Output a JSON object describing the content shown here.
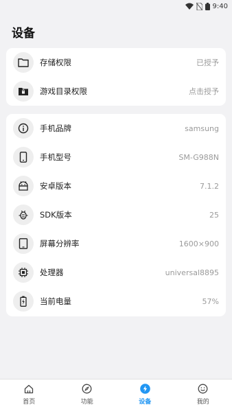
{
  "status_bar": {
    "time": "9:40"
  },
  "header": {
    "title": "设备"
  },
  "permissions": [
    {
      "label": "存储权限",
      "value": "已授予",
      "icon": "folder-icon"
    },
    {
      "label": "游戏目录权限",
      "value": "点击授予",
      "icon": "folder-lock-icon"
    }
  ],
  "device_info": [
    {
      "label": "手机品牌",
      "value": "samsung",
      "icon": "info-icon"
    },
    {
      "label": "手机型号",
      "value": "SM-G988N",
      "icon": "phone-icon"
    },
    {
      "label": "安卓版本",
      "value": "7.1.2",
      "icon": "android-icon"
    },
    {
      "label": "SDK版本",
      "value": "25",
      "icon": "bug-icon"
    },
    {
      "label": "屏幕分辨率",
      "value": "1600×900",
      "icon": "tablet-icon"
    },
    {
      "label": "处理器",
      "value": "universal8895",
      "icon": "cpu-icon"
    },
    {
      "label": "当前电量",
      "value": "57%",
      "icon": "battery-icon"
    }
  ],
  "bottom_nav": [
    {
      "label": "首页",
      "icon": "home-icon",
      "active": false
    },
    {
      "label": "功能",
      "icon": "compass-icon",
      "active": false
    },
    {
      "label": "设备",
      "icon": "bolt-icon",
      "active": true
    },
    {
      "label": "我的",
      "icon": "smile-icon",
      "active": false
    }
  ],
  "colors": {
    "accent": "#2196f3",
    "background": "#f2f2f4",
    "card": "#ffffff"
  }
}
